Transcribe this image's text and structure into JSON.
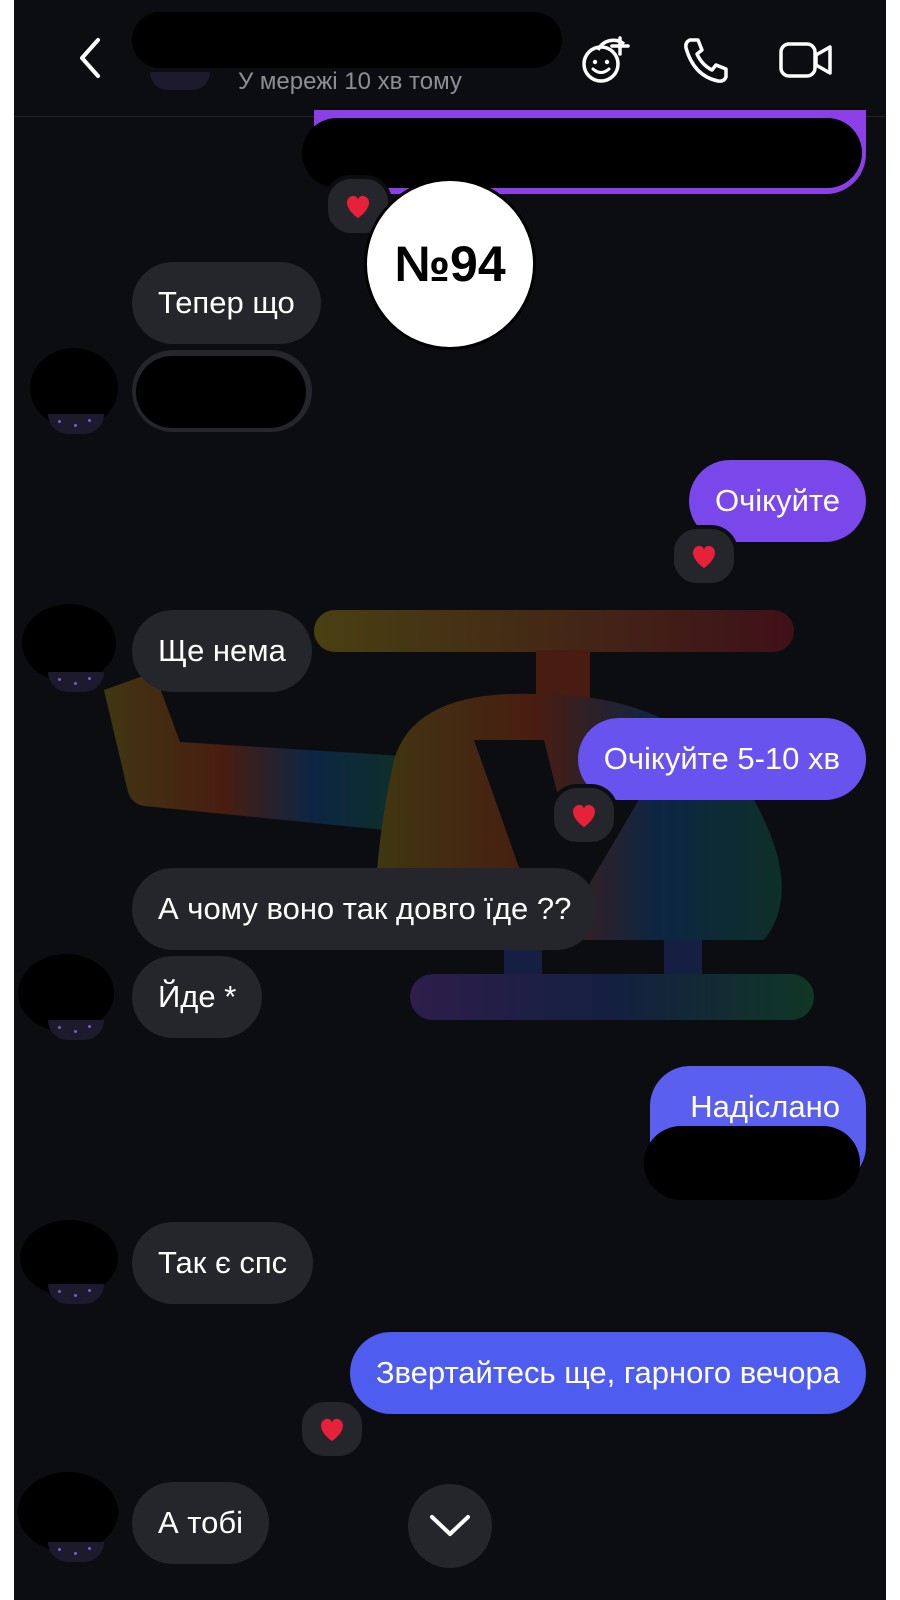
{
  "header": {
    "status": "У мережі 10 хв тому",
    "icons": [
      "back-chevron-icon",
      "effects-sticker-icon",
      "phone-call-icon",
      "video-call-icon"
    ]
  },
  "badge": {
    "label": "№94"
  },
  "messages": [
    {
      "id": "m1",
      "side": "outgoing",
      "text": "",
      "redacted": true,
      "reaction": "❤️"
    },
    {
      "id": "m2",
      "side": "incoming",
      "text": "Тепер що"
    },
    {
      "id": "m3",
      "side": "incoming",
      "text": "",
      "redacted": true
    },
    {
      "id": "m4",
      "side": "outgoing",
      "text": "Очікуйте",
      "reaction": "❤️"
    },
    {
      "id": "m5",
      "side": "incoming",
      "text": "Ще нема"
    },
    {
      "id": "m6",
      "side": "outgoing",
      "text": "Очікуйте 5-10 хв",
      "reaction": "❤️"
    },
    {
      "id": "m7",
      "side": "incoming",
      "text": "А чому воно так довго їде ??"
    },
    {
      "id": "m8",
      "side": "incoming",
      "text": "Йде *"
    },
    {
      "id": "m9",
      "side": "outgoing",
      "text": "Надіслано"
    },
    {
      "id": "m10",
      "side": "incoming",
      "text": "Так є спс"
    },
    {
      "id": "m11",
      "side": "outgoing",
      "text": "Звертайтесь ще, гарного вечора",
      "reaction": "❤️"
    },
    {
      "id": "m12",
      "side": "incoming",
      "text": "А тобі"
    }
  ],
  "colors": {
    "background": "#0c0d11",
    "incoming_bubble": "#25262c",
    "outgoing_gradient_top": "#8b3fe6",
    "outgoing_gradient_bottom": "#5a5ff0",
    "heart": "#e8213a"
  },
  "scroll_button_icon": "chevron-down-icon"
}
